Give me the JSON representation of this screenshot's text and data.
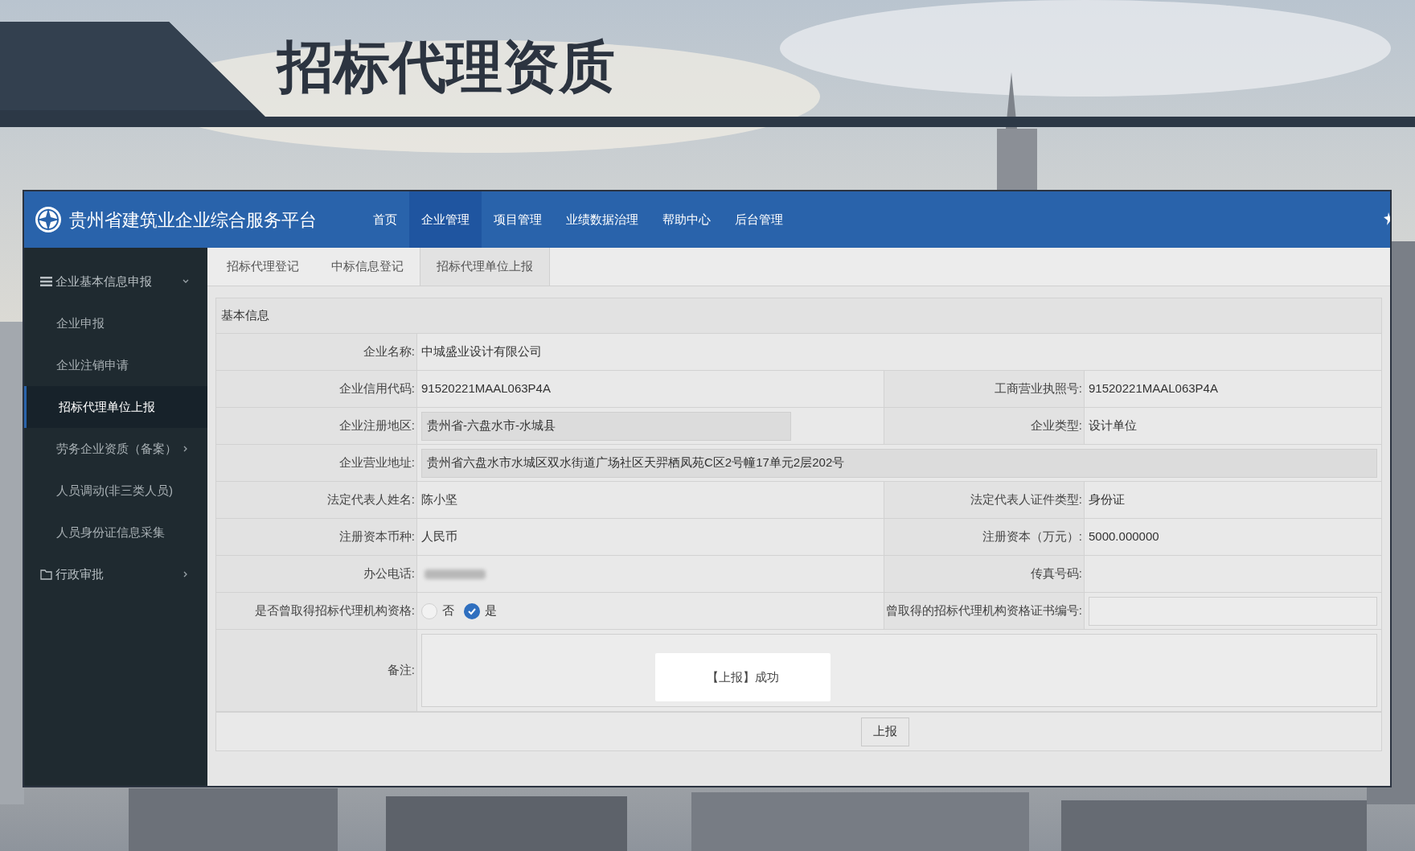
{
  "slide_title": "招标代理资质",
  "app": {
    "title": "贵州省建筑业企业综合服务平台",
    "nav": [
      {
        "label": "首页",
        "selected": false
      },
      {
        "label": "企业管理",
        "selected": true
      },
      {
        "label": "项目管理",
        "selected": false
      },
      {
        "label": "业绩数据治理",
        "selected": false
      },
      {
        "label": "帮助中心",
        "selected": false
      },
      {
        "label": "后台管理",
        "selected": false
      }
    ]
  },
  "sidebar": [
    {
      "label": "企业基本信息申报",
      "kind": "menu",
      "expanded": true,
      "children": [
        {
          "label": "企业申报",
          "selected": false
        },
        {
          "label": "企业注销申请",
          "selected": false
        },
        {
          "label": "招标代理单位上报",
          "selected": true
        },
        {
          "label": "劳务企业资质（备案）",
          "selected": false,
          "expanded": false
        },
        {
          "label": "人员调动(非三类人员)",
          "selected": false
        },
        {
          "label": "人员身份证信息采集",
          "selected": false
        }
      ]
    },
    {
      "label": "行政审批",
      "kind": "folder",
      "expanded": false
    }
  ],
  "tabs": [
    {
      "label": "招标代理登记",
      "selected": false
    },
    {
      "label": "中标信息登记",
      "selected": false
    },
    {
      "label": "招标代理单位上报",
      "selected": true
    }
  ],
  "section_title": "基本信息",
  "rows": [
    {
      "cells": [
        {
          "label": "企业名称:",
          "kind": "text",
          "value": "中城盛业设计有限公司",
          "span": true
        }
      ]
    },
    {
      "cells": [
        {
          "label": "企业信用代码:",
          "kind": "text",
          "value": "91520221MAAL063P4A"
        },
        {
          "label": "工商营业执照号:",
          "kind": "text",
          "value": "91520221MAAL063P4A"
        }
      ]
    },
    {
      "cells": [
        {
          "label": "企业注册地区:",
          "kind": "input",
          "value": "贵州省-六盘水市-水城县"
        },
        {
          "label": "企业类型:",
          "kind": "text",
          "value": "设计单位"
        }
      ]
    },
    {
      "cells": [
        {
          "label": "企业营业地址:",
          "kind": "input",
          "value": "贵州省六盘水市水城区双水街道广场社区天羿栖凤苑C区2号幢17单元2层202号",
          "span": true
        }
      ]
    },
    {
      "cells": [
        {
          "label": "法定代表人姓名:",
          "kind": "text",
          "value": "陈小坚"
        },
        {
          "label": "法定代表人证件类型:",
          "kind": "text",
          "value": "身份证"
        }
      ]
    },
    {
      "cells": [
        {
          "label": "注册资本币种:",
          "kind": "text",
          "value": "人民币"
        },
        {
          "label": "注册资本（万元）:",
          "kind": "text",
          "value": "5000.000000"
        }
      ]
    },
    {
      "cells": [
        {
          "label": "办公电话:",
          "kind": "blurred"
        },
        {
          "label": "传真号码:",
          "kind": "empty"
        }
      ]
    },
    {
      "cells": [
        {
          "label": "是否曾取得招标代理机构资格:",
          "kind": "radio",
          "options": [
            {
              "label": "否",
              "selected": false
            },
            {
              "label": "是",
              "selected": true
            }
          ]
        },
        {
          "label": "曾取得的招标代理机构资格证书编号:",
          "kind": "input"
        }
      ]
    },
    {
      "cells": [
        {
          "label": "备注:",
          "kind": "textarea",
          "span": true
        }
      ]
    }
  ],
  "submit_button": "上报",
  "toast": "【上报】成功"
}
